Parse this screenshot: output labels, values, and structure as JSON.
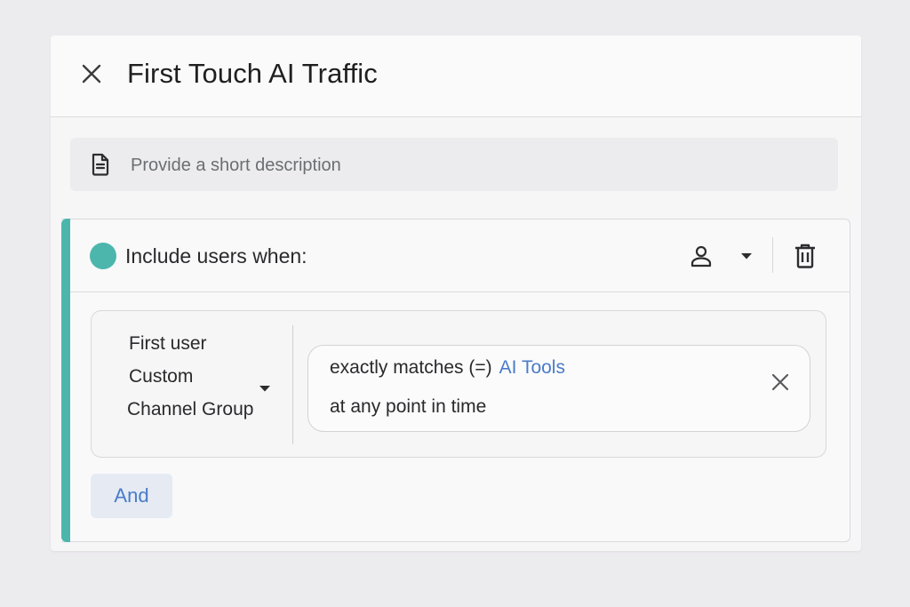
{
  "header": {
    "title": "First Touch AI Traffic",
    "close_icon": "close-icon"
  },
  "description": {
    "placeholder": "Provide a short description",
    "value": "",
    "icon": "document-icon"
  },
  "group": {
    "accent_color": "#4db6ac",
    "label": "Include users when:",
    "scope_icon": "person-icon",
    "dropdown_icon": "caret-down-icon",
    "delete_icon": "trash-icon",
    "condition": {
      "dimension_lines": [
        "First user",
        "Custom",
        "Channel Group"
      ],
      "operator": "exactly matches (=)",
      "value": "AI Tools",
      "value_color": "#4a7bc8",
      "time_scope": "at any point in time",
      "remove_icon": "close-icon"
    },
    "and_button": {
      "label": "And",
      "color": "#4a7bc8"
    }
  }
}
